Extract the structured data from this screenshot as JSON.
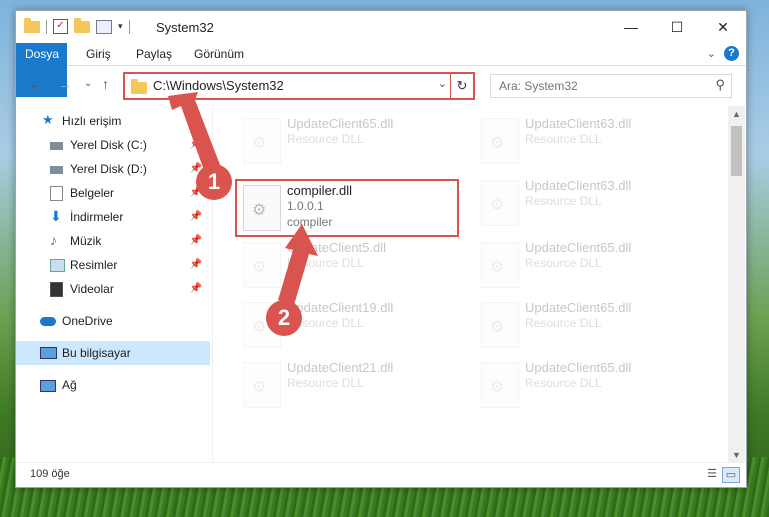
{
  "window": {
    "title": "System32",
    "controls": {
      "minimize": "—",
      "maximize": "☐",
      "close": "✕"
    }
  },
  "ribbon": {
    "tabs": [
      "Dosya",
      "Giriş",
      "Paylaş",
      "Görünüm"
    ]
  },
  "address": {
    "path": "C:\\Windows\\System32",
    "search_placeholder": "Ara: System32"
  },
  "sidebar": {
    "items": [
      {
        "label": "Hızlı erişim",
        "icon": "star-icon"
      },
      {
        "label": "Yerel Disk (C:)",
        "icon": "drive-icon"
      },
      {
        "label": "Yerel Disk (D:)",
        "icon": "drive-icon"
      },
      {
        "label": "Belgeler",
        "icon": "documents-icon"
      },
      {
        "label": "İndirmeler",
        "icon": "download-icon"
      },
      {
        "label": "Müzik",
        "icon": "music-icon"
      },
      {
        "label": "Resimler",
        "icon": "pictures-icon"
      },
      {
        "label": "Videolar",
        "icon": "videos-icon"
      },
      {
        "label": "OneDrive",
        "icon": "cloud-icon"
      },
      {
        "label": "Bu bilgisayar",
        "icon": "computer-icon"
      },
      {
        "label": "Ağ",
        "icon": "network-icon"
      }
    ]
  },
  "files": {
    "left": [
      {
        "name": "UpdateClient65.dll",
        "desc": "Resource DLL"
      },
      {
        "name": "compiler.dll",
        "desc": "1.0.0.1",
        "desc2": "compiler"
      },
      {
        "name": "UpdateClient5.dll",
        "desc": "Resource DLL"
      },
      {
        "name": "UpdateClient19.dll",
        "desc": "Resource DLL"
      },
      {
        "name": "UpdateClient21.dll",
        "desc": "Resource DLL"
      }
    ],
    "right": [
      {
        "name": "UpdateClient63.dll",
        "desc": "Resource DLL"
      },
      {
        "name": "UpdateClient63.dll",
        "desc": "Resource DLL"
      },
      {
        "name": "UpdateClient65.dll",
        "desc": "Resource DLL"
      },
      {
        "name": "UpdateClient65.dll",
        "desc": "Resource DLL"
      },
      {
        "name": "UpdateClient65.dll",
        "desc": "Resource DLL"
      }
    ]
  },
  "status": {
    "count": "109 öğe"
  },
  "callouts": {
    "one": "1",
    "two": "2"
  },
  "colors": {
    "accent": "#1979ca",
    "highlight": "#d9534f"
  }
}
